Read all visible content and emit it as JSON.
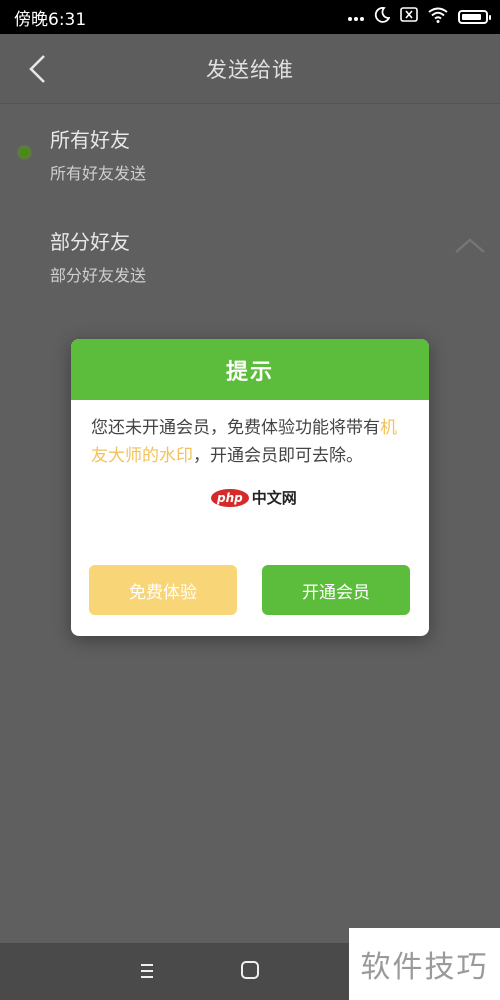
{
  "status_bar": {
    "time": "傍晚6:31",
    "icons": [
      "more-dots-icon",
      "moon-icon",
      "sim-card-icon",
      "wifi-icon",
      "battery-icon"
    ],
    "battery_level": 0.85
  },
  "header": {
    "title": "发送给谁"
  },
  "options": [
    {
      "label": "所有好友",
      "sub": "所有好友发送",
      "selected": true
    },
    {
      "label": "部分好友",
      "sub": "部分好友发送",
      "selected": false
    }
  ],
  "dialog": {
    "title": "提示",
    "body_part1": "您还未开通会员，免费体验功能将带有",
    "body_highlight": "机友大师的水印",
    "body_part2": "，开通会员即可去除。",
    "watermark_logo": "php",
    "watermark_text": "中文网",
    "trial_button": "免费体验",
    "member_button": "开通会员"
  },
  "corner_brand": "软件技巧",
  "colors": {
    "accent_green": "#5cbd3c",
    "highlight_yellow": "#f3c25b",
    "trial_button_yellow": "#f8d577",
    "overlay_gray": "#5f5f5f"
  }
}
